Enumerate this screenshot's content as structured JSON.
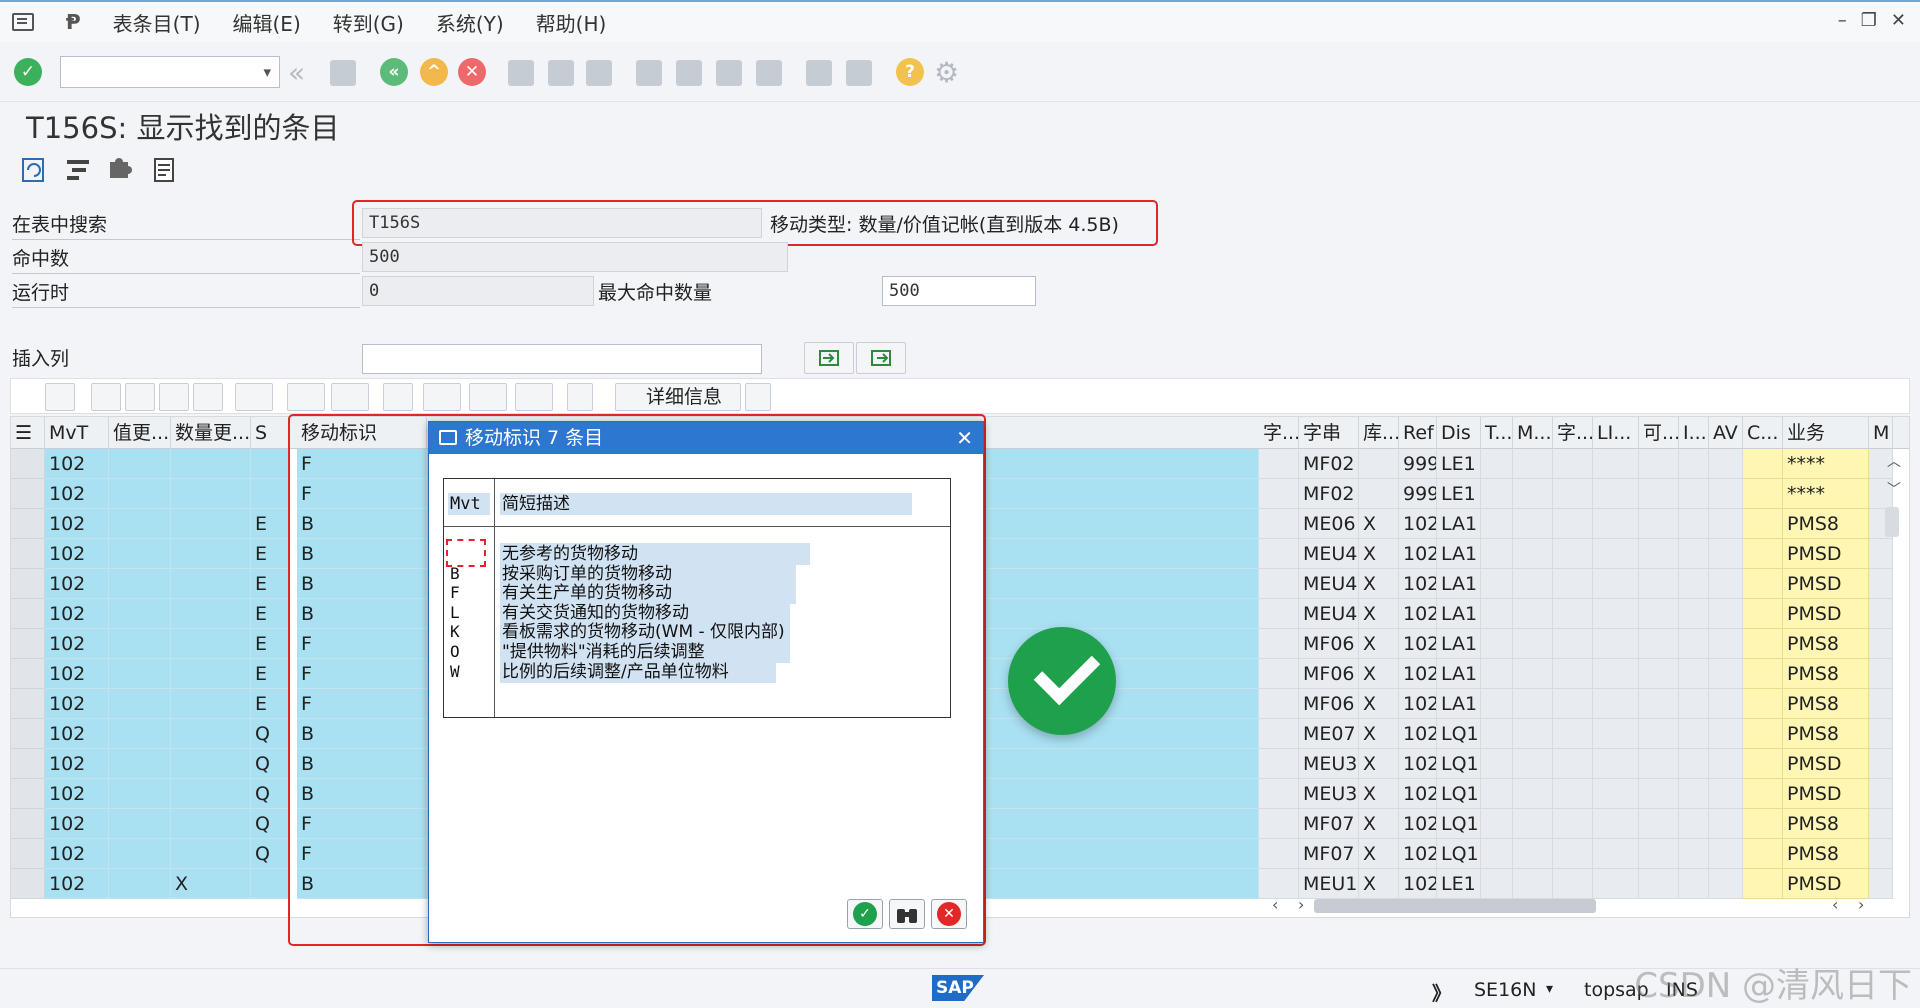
{
  "menu": {
    "items": [
      "表条目(T)",
      "编辑(E)",
      "转到(G)",
      "系统(Y)",
      "帮助(H)"
    ],
    "window_controls": [
      "–",
      "❐",
      "✕"
    ]
  },
  "page_title": "T156S: 显示找到的条目",
  "search": {
    "table_label": "在表中搜索",
    "table_value": "T156S",
    "table_description": "移动类型: 数量/价值记帐(直到版本 4.5B)",
    "hits_label": "命中数",
    "hits_value": "500",
    "runtime_label": "运行时",
    "runtime_value": "0",
    "max_hits_label": "最大命中数量",
    "max_hits_value": "500",
    "insert_col_label": "插入列",
    "insert_col_value": ""
  },
  "alv": {
    "details_label": "详细信息"
  },
  "grid": {
    "columns": [
      "MvT",
      "值更...",
      "数量更...",
      "S",
      "移动标识",
      "字...",
      "字串",
      "库...",
      "Ref",
      "Dis",
      "T...",
      "M...",
      "字...",
      "LI...",
      "可...",
      "I...",
      "AV",
      "C...",
      "业务",
      "M"
    ],
    "rows": [
      {
        "mvt": "102",
        "val": "",
        "qty": "",
        "s": "",
        "mi": "F",
        "str": "MF02",
        "lib": "",
        "ref": "999",
        "dis": "LE1",
        "biz": "****"
      },
      {
        "mvt": "102",
        "val": "",
        "qty": "",
        "s": "",
        "mi": "F",
        "str": "MF02",
        "lib": "",
        "ref": "999",
        "dis": "LE1",
        "biz": "****"
      },
      {
        "mvt": "102",
        "val": "",
        "qty": "",
        "s": "E",
        "mi": "B",
        "str": "ME06",
        "lib": "X",
        "ref": "102",
        "dis": "LA1",
        "biz": "PMS8"
      },
      {
        "mvt": "102",
        "val": "",
        "qty": "",
        "s": "E",
        "mi": "B",
        "str": "MEU4",
        "lib": "X",
        "ref": "102",
        "dis": "LA1",
        "biz": "PMSD"
      },
      {
        "mvt": "102",
        "val": "",
        "qty": "",
        "s": "E",
        "mi": "B",
        "str": "MEU4",
        "lib": "X",
        "ref": "102",
        "dis": "LA1",
        "biz": "PMSD"
      },
      {
        "mvt": "102",
        "val": "",
        "qty": "",
        "s": "E",
        "mi": "B",
        "str": "MEU4",
        "lib": "X",
        "ref": "102",
        "dis": "LA1",
        "biz": "PMSD"
      },
      {
        "mvt": "102",
        "val": "",
        "qty": "",
        "s": "E",
        "mi": "F",
        "str": "MF06",
        "lib": "X",
        "ref": "102",
        "dis": "LA1",
        "biz": "PMS8"
      },
      {
        "mvt": "102",
        "val": "",
        "qty": "",
        "s": "E",
        "mi": "F",
        "str": "MF06",
        "lib": "X",
        "ref": "102",
        "dis": "LA1",
        "biz": "PMS8"
      },
      {
        "mvt": "102",
        "val": "",
        "qty": "",
        "s": "E",
        "mi": "F",
        "str": "MF06",
        "lib": "X",
        "ref": "102",
        "dis": "LA1",
        "biz": "PMS8"
      },
      {
        "mvt": "102",
        "val": "",
        "qty": "",
        "s": "Q",
        "mi": "B",
        "str": "ME07",
        "lib": "X",
        "ref": "102",
        "dis": "LQ1",
        "biz": "PMS8"
      },
      {
        "mvt": "102",
        "val": "",
        "qty": "",
        "s": "Q",
        "mi": "B",
        "str": "MEU3",
        "lib": "X",
        "ref": "102",
        "dis": "LQ1",
        "biz": "PMSD"
      },
      {
        "mvt": "102",
        "val": "",
        "qty": "",
        "s": "Q",
        "mi": "B",
        "str": "MEU3",
        "lib": "X",
        "ref": "102",
        "dis": "LQ1",
        "biz": "PMSD"
      },
      {
        "mvt": "102",
        "val": "",
        "qty": "",
        "s": "Q",
        "mi": "F",
        "str": "MF07",
        "lib": "X",
        "ref": "102",
        "dis": "LQ1",
        "biz": "PMS8"
      },
      {
        "mvt": "102",
        "val": "",
        "qty": "",
        "s": "Q",
        "mi": "F",
        "str": "MF07",
        "lib": "X",
        "ref": "102",
        "dis": "LQ1",
        "biz": "PMS8"
      },
      {
        "mvt": "102",
        "val": "",
        "qty": "X",
        "s": "",
        "mi": "B",
        "str": "MEU1",
        "lib": "X",
        "ref": "102",
        "dis": "LE1",
        "biz": "PMSD"
      }
    ]
  },
  "dialog": {
    "title": "移动标识 7 条目",
    "col_key": "Mvt",
    "col_desc": "简短描述",
    "entries": [
      {
        "key": "",
        "desc": "无参考的货物移动"
      },
      {
        "key": "B",
        "desc": "按采购订单的货物移动"
      },
      {
        "key": "F",
        "desc": "有关生产单的货物移动"
      },
      {
        "key": "L",
        "desc": "有关交货通知的货物移动"
      },
      {
        "key": "K",
        "desc": "看板需求的货物移动(WM - 仅限内部)"
      },
      {
        "key": "O",
        "desc": "\"提供物料\"消耗的后续调整"
      },
      {
        "key": "W",
        "desc": "比例的后续调整/产品单位物料"
      }
    ]
  },
  "status": {
    "sap_logo": "SAP",
    "arrows": "》",
    "tcode": "SE16N",
    "system": "topsap",
    "mode": "INS",
    "watermark": "CSDN @清风日下"
  },
  "colors": {
    "row_blue": "#a9e1f2",
    "highlight_red": "#e0262c",
    "dialog_title": "#2d77d0",
    "biz_yellow": "#fff6b3"
  }
}
